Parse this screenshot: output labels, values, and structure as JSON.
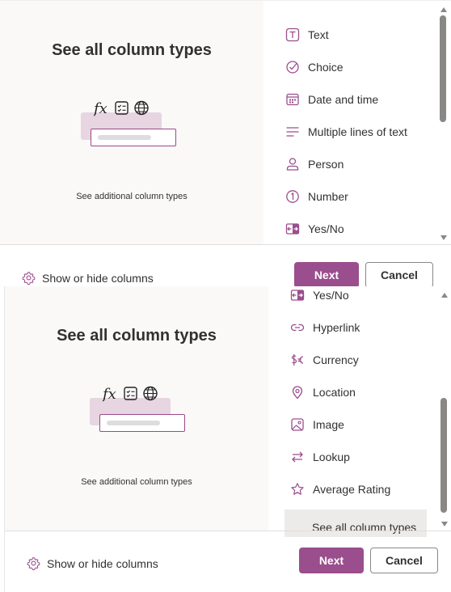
{
  "preview": {
    "title": "See all column types",
    "caption": "See additional column types",
    "glyph_fx": "fx"
  },
  "panel1": {
    "items": [
      {
        "label": "Text",
        "icon": "text-icon"
      },
      {
        "label": "Choice",
        "icon": "choice-icon"
      },
      {
        "label": "Date and time",
        "icon": "calendar-icon"
      },
      {
        "label": "Multiple lines of text",
        "icon": "multiline-icon"
      },
      {
        "label": "Person",
        "icon": "person-icon"
      },
      {
        "label": "Number",
        "icon": "number-icon"
      },
      {
        "label": "Yes/No",
        "icon": "toggle-icon"
      }
    ]
  },
  "panel2": {
    "items": [
      {
        "label": "Yes/No",
        "icon": "toggle-icon"
      },
      {
        "label": "Hyperlink",
        "icon": "link-icon"
      },
      {
        "label": "Currency",
        "icon": "currency-icon"
      },
      {
        "label": "Location",
        "icon": "location-icon"
      },
      {
        "label": "Image",
        "icon": "image-icon"
      },
      {
        "label": "Lookup",
        "icon": "lookup-icon"
      },
      {
        "label": "Average Rating",
        "icon": "star-icon"
      },
      {
        "label": "See all column types",
        "icon": "none",
        "highlighted": true
      }
    ]
  },
  "footer": {
    "show_hide_label": "Show or hide columns",
    "next_label": "Next",
    "cancel_label": "Cancel"
  },
  "colors": {
    "accent": "#9a4e8d",
    "preview_bg": "#faf9f8",
    "illustration_tint": "#e7d5e2"
  }
}
